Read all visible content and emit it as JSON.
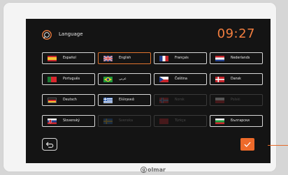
{
  "header": {
    "title": "Language",
    "clock": "09:27"
  },
  "languages": [
    {
      "label": "Español"
    },
    {
      "label": "English"
    },
    {
      "label": "Français"
    },
    {
      "label": "Nederlands"
    },
    {
      "label": "Português"
    },
    {
      "label": "عربي"
    },
    {
      "label": "Čeština"
    },
    {
      "label": "Dansk"
    },
    {
      "label": "Deutsch"
    },
    {
      "label": "Ελληνικά"
    },
    {
      "label": "Norsk"
    },
    {
      "label": "Polski"
    },
    {
      "label": "Slovenský"
    },
    {
      "label": "Svenska"
    },
    {
      "label": "Türkçe"
    },
    {
      "label": "Български"
    }
  ],
  "selected_language": "English",
  "disabled_languages": [
    "Norsk",
    "Polski",
    "Svenska",
    "Türkçe"
  ],
  "footer": {
    "brand": "olmar"
  },
  "colors": {
    "accent": "#ee6a2a",
    "background": "#141414",
    "selected_border": "#e0742f"
  },
  "icons": {
    "header": "language-icon",
    "back": "back-arrow-icon",
    "confirm": "checkmark-icon"
  }
}
